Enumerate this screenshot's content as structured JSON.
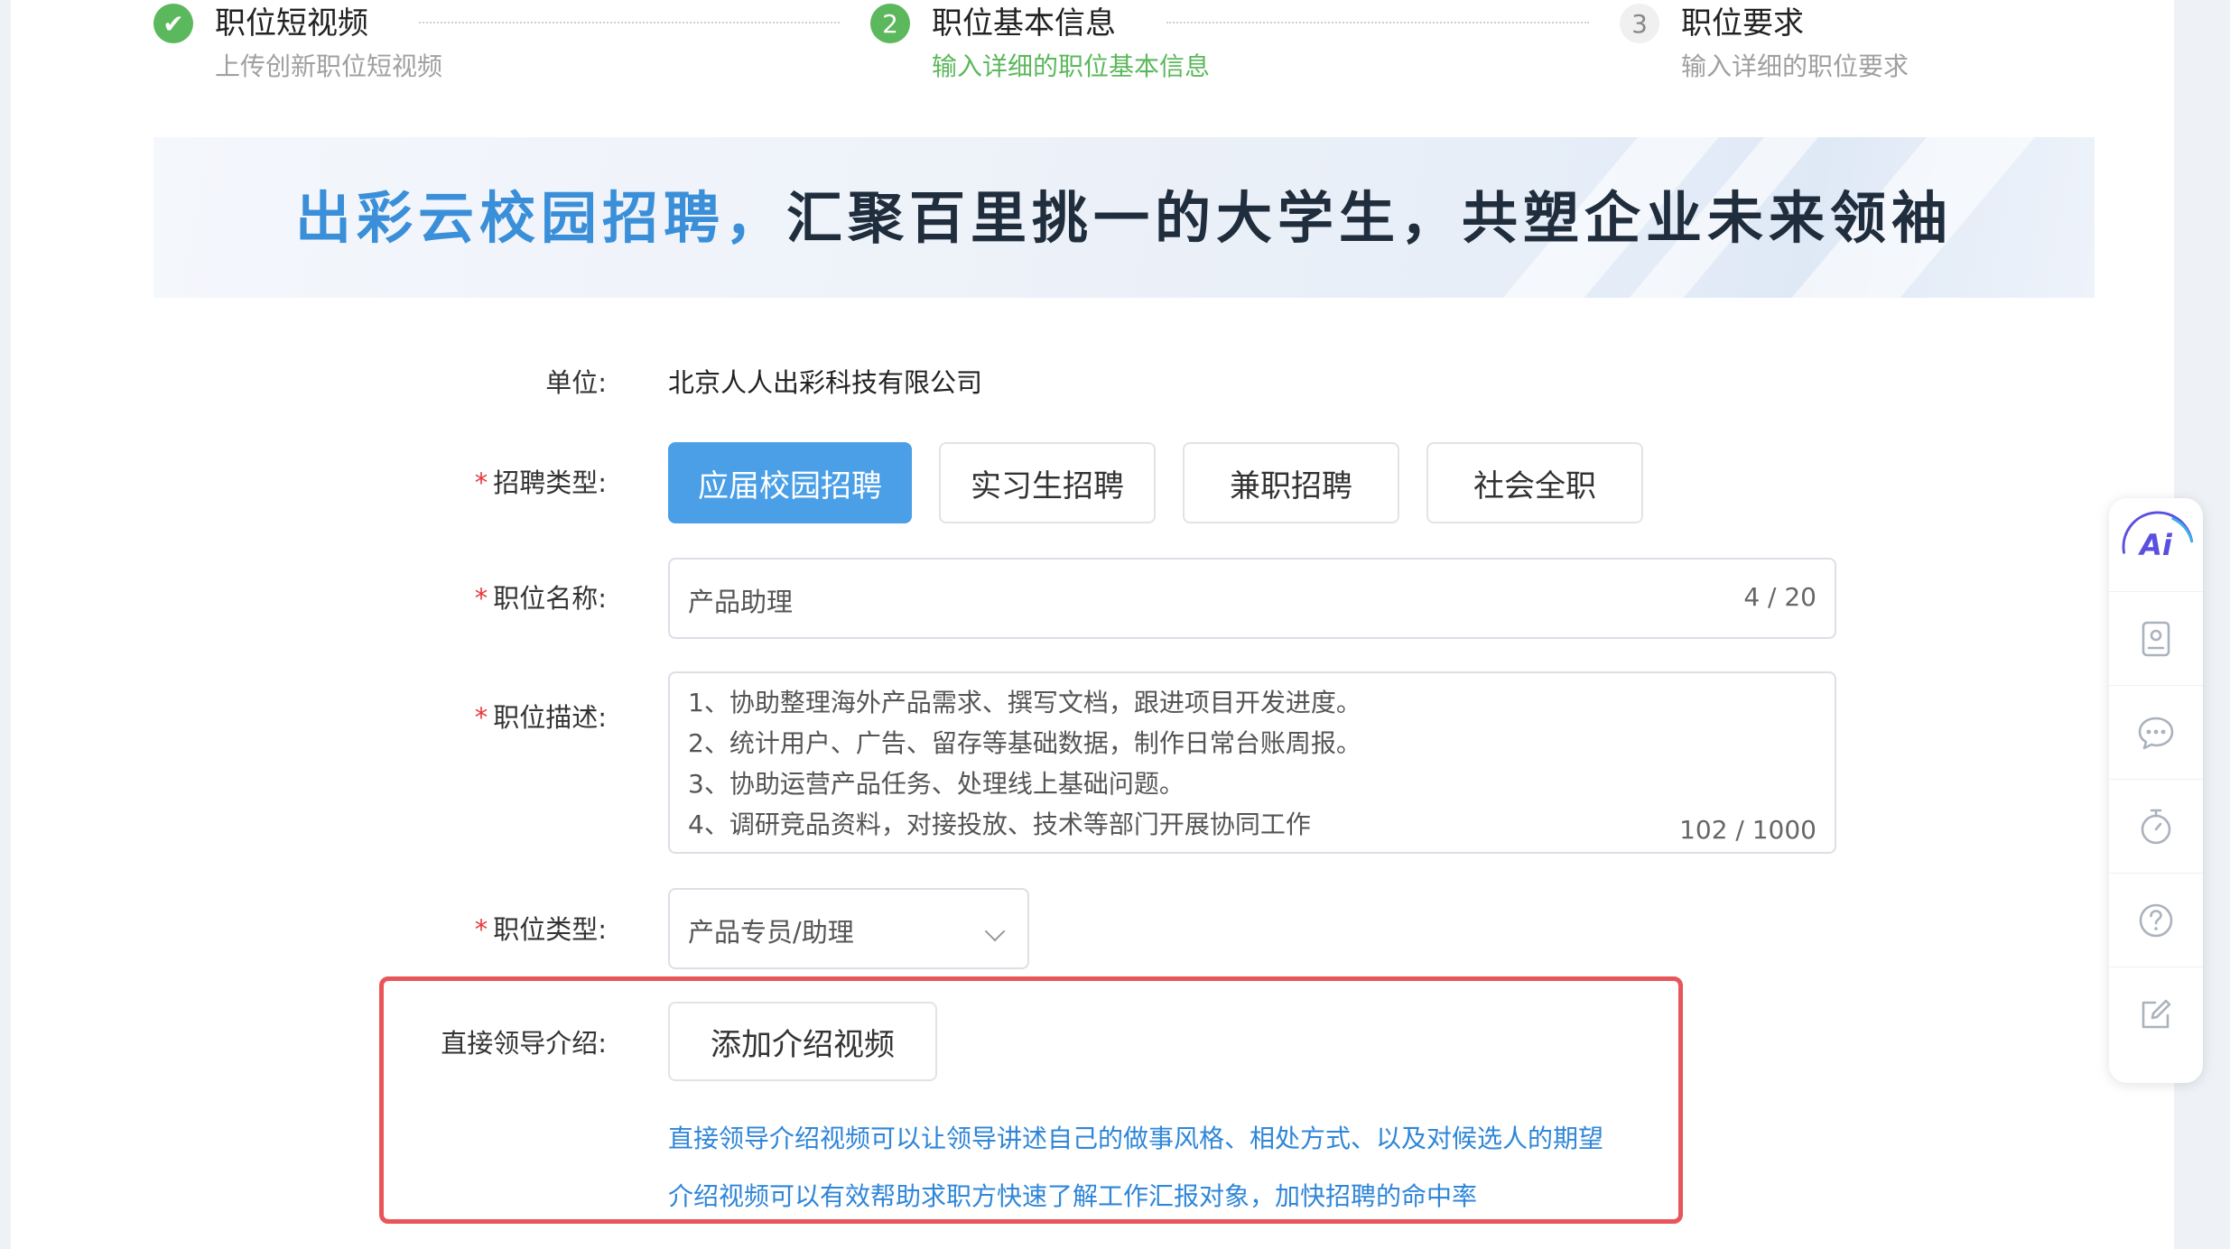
{
  "steps": [
    {
      "title": "职位短视频",
      "subtitle": "上传创新职位短视频",
      "status": "done",
      "badge": "✔"
    },
    {
      "title": "职位基本信息",
      "subtitle": "输入详细的职位基本信息",
      "status": "active",
      "badge": "2"
    },
    {
      "title": "职位要求",
      "subtitle": "输入详细的职位要求",
      "status": "pending",
      "badge": "3"
    }
  ],
  "banner": {
    "part1": "出彩云校园招聘，",
    "part2": "汇聚百里挑一的大学生，共塑企业未来领袖"
  },
  "form": {
    "company": {
      "label": "单位:",
      "value": "北京人人出彩科技有限公司"
    },
    "recruit_type": {
      "label": "招聘类型:",
      "options": [
        "应届校园招聘",
        "实习生招聘",
        "兼职招聘",
        "社会全职"
      ],
      "selected": "应届校园招聘"
    },
    "job_name": {
      "label": "职位名称:",
      "value": "产品助理",
      "counter": "4 / 20"
    },
    "job_desc": {
      "label": "职位描述:",
      "lines": [
        "1、协助整理海外产品需求、撰写文档，跟进项目开发进度。",
        "2、统计用户、广告、留存等基础数据，制作日常台账周报。",
        "3、协助运营产品任务、处理线上基础问题。",
        "4、调研竞品资料，对接投放、技术等部门开展协同工作"
      ],
      "counter": "102 / 1000"
    },
    "job_category": {
      "label": "职位类型:",
      "value": "产品专员/助理"
    },
    "leader_intro": {
      "label": "直接领导介绍:",
      "button": "添加介绍视频",
      "hint1": "直接领导介绍视频可以让领导讲述自己的做事风格、相处方式、以及对候选人的期望",
      "hint2": "介绍视频可以有效帮助求职方快速了解工作汇报对象，加快招聘的命中率"
    },
    "required_mark": "*"
  },
  "toolbar": {
    "ai_label": "Ai",
    "icons": [
      "ai-icon",
      "contact-card-icon",
      "chat-icon",
      "timer-icon",
      "help-icon",
      "edit-icon"
    ]
  },
  "colors": {
    "accent": "#4a9fe6",
    "step_green": "#5cb85c",
    "hint_blue": "#2f86d8",
    "highlight_red": "#e8565a",
    "required_red": "#e4393c"
  }
}
